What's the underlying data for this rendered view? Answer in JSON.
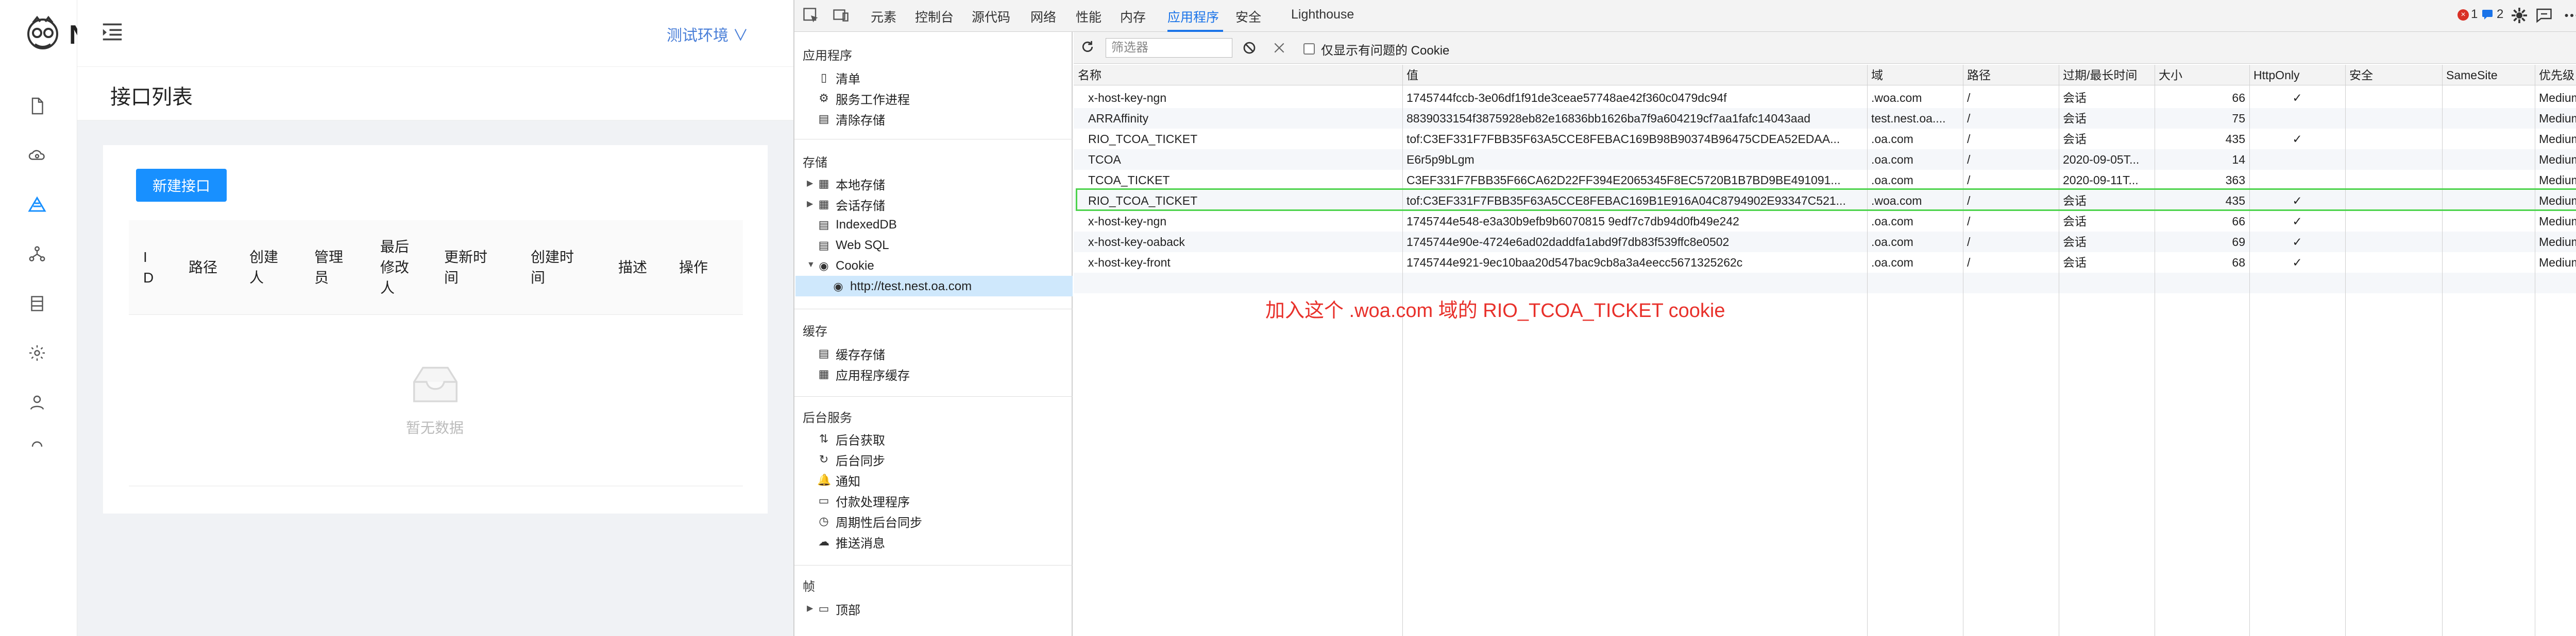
{
  "app": {
    "logo_initial": "N",
    "env_label": "测试环境 ∨",
    "page_title": "接口列表",
    "new_button": "新建接口",
    "table_headers": [
      {
        "line1": "I",
        "line2": "D"
      },
      {
        "line1": "路径",
        "line2": ""
      },
      {
        "line1": "创建",
        "line2": "人"
      },
      {
        "line1": "管理",
        "line2": "员"
      },
      {
        "line1": "最后",
        "line2": "修改",
        "line3": "人"
      },
      {
        "line1": "更新时",
        "line2": "间"
      },
      {
        "line1": "创建时",
        "line2": "间"
      },
      {
        "line1": "描述",
        "line2": ""
      },
      {
        "line1": "操作",
        "line2": ""
      }
    ],
    "empty_text": "暂无数据",
    "sidebar_icons": [
      "file-icon",
      "cloud-icon",
      "triangle-icon",
      "share-icon",
      "database-icon",
      "gear-icon",
      "user-icon",
      "loading-icon"
    ]
  },
  "devtools": {
    "tabs": [
      "元素",
      "控制台",
      "源代码",
      "网络",
      "性能",
      "内存",
      "应用程序",
      "安全",
      "Lighthouse"
    ],
    "active_tab": "应用程序",
    "error_count": "1",
    "message_count": "2",
    "filter_placeholder": "筛选器",
    "issues_only_label": "仅显示有问题的 Cookie",
    "sidebar": {
      "app_section": "应用程序",
      "app_items": [
        "清单",
        "服务工作进程",
        "清除存储"
      ],
      "storage_section": "存储",
      "storage_items": [
        "本地存储",
        "会话存储",
        "IndexedDB",
        "Web SQL",
        "Cookie"
      ],
      "cookie_origin": "http://test.nest.oa.com",
      "cache_section": "缓存",
      "cache_items": [
        "缓存存储",
        "应用程序缓存"
      ],
      "bg_section": "后台服务",
      "bg_items": [
        "后台获取",
        "后台同步",
        "通知",
        "付款处理程序",
        "周期性后台同步",
        "推送消息"
      ],
      "frames_section": "帧",
      "frames_items": [
        "顶部"
      ]
    },
    "columns": [
      "名称",
      "值",
      "域",
      "路径",
      "过期/最长时间",
      "大小",
      "HttpOnly",
      "安全",
      "SameSite",
      "优先级"
    ],
    "rows": [
      [
        "x-host-key-ngn",
        "1745744fccb-3e06df1f91de3ceae57748ae42f360c0479dc94f",
        ".woa.com",
        "/",
        "会话",
        "66",
        "✓",
        "",
        "",
        "Medium"
      ],
      [
        "ARRAffinity",
        "8839033154f3875928eb82e16836bb1626ba7f9a604219cf7aa1fafc14043aad",
        "test.nest.oa....",
        "/",
        "会话",
        "75",
        "",
        "",
        "",
        "Medium"
      ],
      [
        "RIO_TCOA_TICKET",
        "tof:C3EF331F7FBB35F63A5CCE8FEBAC169B98B90374B96475CDEA52EDAA...",
        ".oa.com",
        "/",
        "会话",
        "435",
        "✓",
        "",
        "",
        "Medium"
      ],
      [
        "TCOA",
        "E6r5p9bLgm",
        ".oa.com",
        "/",
        "2020-09-05T...",
        "14",
        "",
        "",
        "",
        "Medium"
      ],
      [
        "TCOA_TICKET",
        "C3EF331F7FBB35F66CA62D22FF394E2065345F8EC5720B1B7BD9BE491091...",
        ".oa.com",
        "/",
        "2020-09-11T...",
        "363",
        "",
        "",
        "",
        "Medium"
      ],
      [
        "RIO_TCOA_TICKET",
        "tof:C3EF331F7FBB35F63A5CCE8FEBAC169B1E916A04C8794902E93347C521...",
        ".woa.com",
        "/",
        "会话",
        "435",
        "✓",
        "",
        "",
        "Medium"
      ],
      [
        "x-host-key-ngn",
        "1745744e548-e3a30b9efb9b6070815 9edf7c7db94d0fb49e242",
        ".oa.com",
        "/",
        "会话",
        "66",
        "✓",
        "",
        "",
        "Medium"
      ],
      [
        "x-host-key-oaback",
        "1745744e90e-4724e6ad02daddfa1abd9f7db83f539ffc8e0502",
        ".oa.com",
        "/",
        "会话",
        "69",
        "✓",
        "",
        "",
        "Medium"
      ],
      [
        "x-host-key-front",
        "1745744e921-9ec10baa20d547bac9cb8a3a4eecc5671325262c",
        ".oa.com",
        "/",
        "会话",
        "68",
        "✓",
        "",
        "",
        "Medium"
      ]
    ],
    "annotation": "加入这个 .woa.com 域的 RIO_TCOA_TICKET cookie"
  }
}
